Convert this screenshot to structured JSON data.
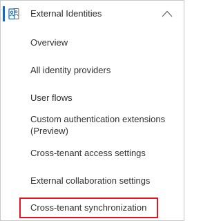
{
  "nav": {
    "group": {
      "title": "External Identities",
      "icon": "external-identities-icon",
      "expanded": true,
      "accent_color": "#0f6cbd"
    },
    "items": [
      {
        "label": "Overview"
      },
      {
        "label": "All identity providers"
      },
      {
        "label": "User flows"
      },
      {
        "label": "Custom authentication extensions (Preview)"
      },
      {
        "label": "Cross-tenant access settings"
      },
      {
        "label": "External collaboration settings"
      },
      {
        "label": "Cross-tenant synchronization",
        "highlighted": true,
        "highlight_color": "#e8111c"
      }
    ]
  }
}
